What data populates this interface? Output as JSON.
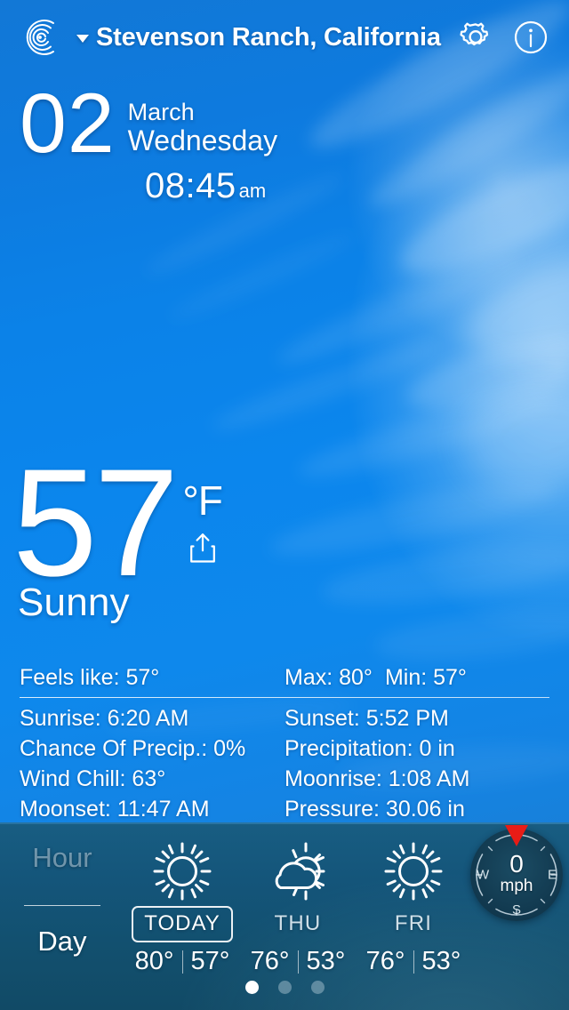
{
  "header": {
    "logo_icon": "radar-spiral-icon",
    "caret_icon": "chevron-down-icon",
    "location": "Stevenson Ranch, California",
    "settings_icon": "gear-icon",
    "info_icon": "info-circle-icon"
  },
  "date": {
    "day_number": "02",
    "month": "March",
    "weekday": "Wednesday",
    "time": "08:45",
    "meridiem": "am"
  },
  "current": {
    "temperature": "57",
    "unit": "°F",
    "share_icon": "share-upload-icon",
    "condition": "Sunny"
  },
  "summary": {
    "feels_like": "Feels like: 57°",
    "max": "Max: 80°",
    "min": "Min: 57°"
  },
  "details": {
    "left": [
      "Sunrise: 6:20 AM",
      "Chance Of Precip.: 0%",
      "Wind Chill: 63°",
      "Moonset: 11:47 AM"
    ],
    "right": [
      "Sunset: 5:52 PM",
      "Precipitation: 0 in",
      "Moonrise: 1:08 AM",
      "Pressure: 30.06 in"
    ]
  },
  "bottom_bar": {
    "toggle": {
      "hour_label": "Hour",
      "day_label": "Day",
      "active": "Day"
    },
    "forecast": [
      {
        "label": "TODAY",
        "icon": "sun-icon",
        "high": "80°",
        "low": "57°",
        "selected": true
      },
      {
        "label": "THU",
        "icon": "sun-behind-cloud-icon",
        "high": "76°",
        "low": "53°",
        "selected": false
      },
      {
        "label": "FRI",
        "icon": "sun-icon",
        "high": "76°",
        "low": "53°",
        "selected": false
      }
    ],
    "compass": {
      "value": "0",
      "unit": "mph",
      "west": "W",
      "east": "E",
      "south": "S",
      "needle_color": "#e81c16"
    },
    "pager": {
      "count": 3,
      "active_index": 0
    }
  },
  "colors": {
    "sky_blue": "#0b82e8",
    "bar_teal": "#14557a",
    "text_white": "#ffffff",
    "needle_red": "#e81c16"
  }
}
